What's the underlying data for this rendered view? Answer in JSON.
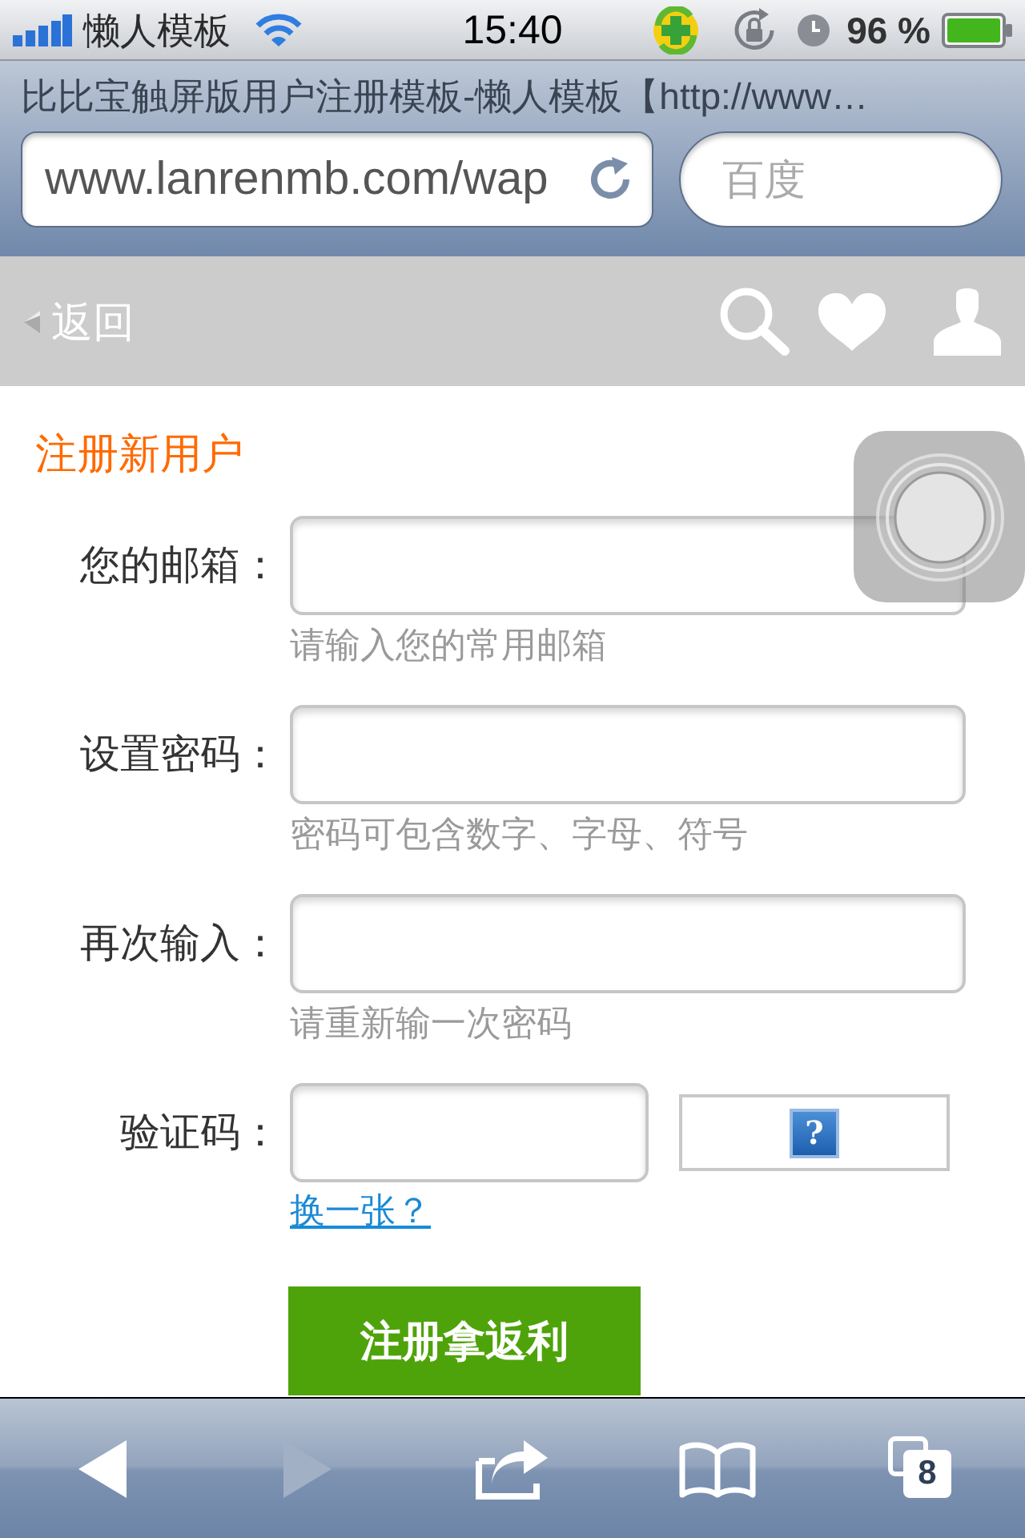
{
  "status_bar": {
    "carrier": "懒人模板",
    "time": "15:40",
    "battery": "96 %"
  },
  "browser": {
    "page_title": "比比宝触屏版用户注册模板-懒人模板【http://www…",
    "address": "www.lanrenmb.com/wap",
    "search_placeholder": "百度"
  },
  "nav_bar": {
    "back_label": "返回"
  },
  "form": {
    "title": "注册新用户",
    "fields": [
      {
        "kind": "text",
        "label": "您的邮箱：",
        "hint": "请输入您的常用邮箱"
      },
      {
        "kind": "text",
        "label": "设置密码：",
        "hint": "密码可包含数字、字母、符号"
      },
      {
        "kind": "text",
        "label": "再次输入：",
        "hint": "请重新输一次密码"
      },
      {
        "kind": "captcha",
        "label": "验证码：",
        "image_glyph": "?",
        "link": "换一张？"
      }
    ],
    "submit": "注册拿返利"
  },
  "toolbar": [
    {
      "kind": "back",
      "disabled": false
    },
    {
      "kind": "forward",
      "disabled": true
    },
    {
      "kind": "share",
      "disabled": false
    },
    {
      "kind": "bookmarks",
      "disabled": false
    },
    {
      "kind": "tabs",
      "disabled": false,
      "count": "8"
    }
  ]
}
